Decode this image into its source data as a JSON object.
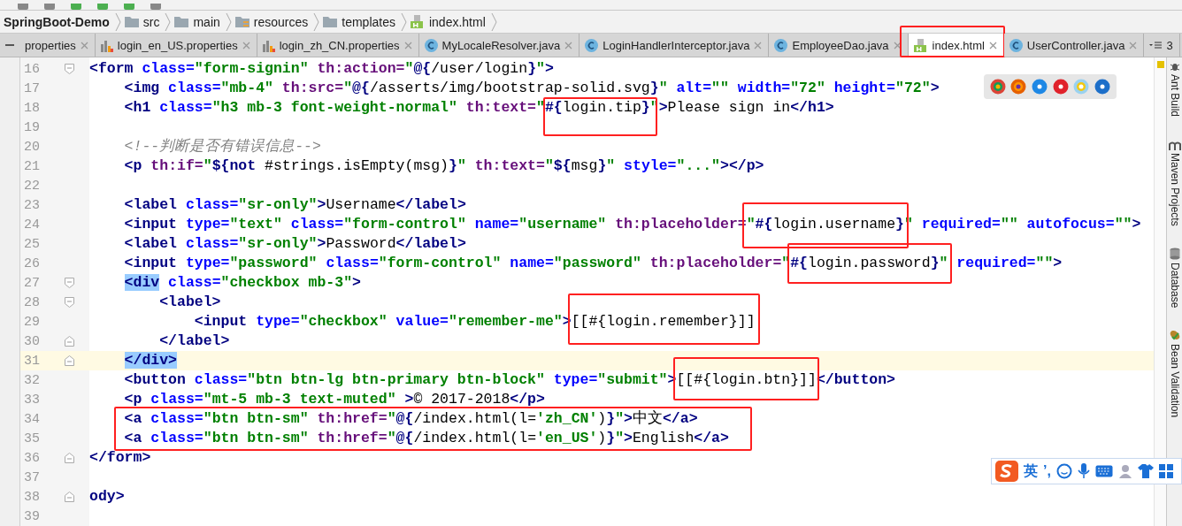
{
  "breadcrumbs": [
    {
      "label": "SpringBoot-Demo",
      "kind": "project"
    },
    {
      "label": "src",
      "kind": "folder"
    },
    {
      "label": "main",
      "kind": "folder"
    },
    {
      "label": "resources",
      "kind": "resources"
    },
    {
      "label": "templates",
      "kind": "folder"
    },
    {
      "label": "index.html",
      "kind": "html"
    }
  ],
  "tabs": [
    {
      "label": "properties",
      "kind": "cut",
      "selected": false
    },
    {
      "label": "login_en_US.properties",
      "kind": "properties",
      "selected": false
    },
    {
      "label": "login_zh_CN.properties",
      "kind": "properties",
      "selected": false
    },
    {
      "label": "MyLocaleResolver.java",
      "kind": "java",
      "selected": false
    },
    {
      "label": "LoginHandlerInterceptor.java",
      "kind": "java",
      "selected": false
    },
    {
      "label": "EmployeeDao.java",
      "kind": "java",
      "selected": false
    },
    {
      "label": "index.html",
      "kind": "html",
      "selected": true
    },
    {
      "label": "UserController.java",
      "kind": "java",
      "selected": false
    }
  ],
  "tab_overflow": "3",
  "lines": [
    {
      "number": "16",
      "fold_open": true,
      "fold_close": false,
      "current": false,
      "tokens": [
        {
          "kind": "tag",
          "text": "<form"
        },
        {
          "kind": "attr",
          "text": " class="
        },
        {
          "kind": "val",
          "text": "\"form-signin\""
        },
        {
          "kind": "th",
          "text": " th:action="
        },
        {
          "kind": "val",
          "text": "\""
        },
        {
          "kind": "tag",
          "text": "@{"
        },
        {
          "kind": "plain",
          "text": "/user/login"
        },
        {
          "kind": "tag",
          "text": "}"
        },
        {
          "kind": "val",
          "text": "\""
        },
        {
          "kind": "tag",
          "text": ">"
        }
      ]
    },
    {
      "number": "17",
      "fold_open": false,
      "fold_close": false,
      "current": false,
      "tokens": [
        {
          "kind": "tag",
          "text": "    <img"
        },
        {
          "kind": "attr",
          "text": " class="
        },
        {
          "kind": "val",
          "text": "\"mb-4\""
        },
        {
          "kind": "th",
          "text": " th:src="
        },
        {
          "kind": "val",
          "text": "\""
        },
        {
          "kind": "tag",
          "text": "@{"
        },
        {
          "kind": "plain",
          "text": "/asserts/img/bootstrap-solid.svg"
        },
        {
          "kind": "tag",
          "text": "}"
        },
        {
          "kind": "val",
          "text": "\""
        },
        {
          "kind": "attr",
          "text": " alt="
        },
        {
          "kind": "val",
          "text": "\"\""
        },
        {
          "kind": "attr",
          "text": " width="
        },
        {
          "kind": "val",
          "text": "\"72\""
        },
        {
          "kind": "attr",
          "text": " height="
        },
        {
          "kind": "val",
          "text": "\"72\""
        },
        {
          "kind": "tag",
          "text": ">"
        }
      ]
    },
    {
      "number": "18",
      "fold_open": false,
      "fold_close": false,
      "current": false,
      "tokens": [
        {
          "kind": "tag",
          "text": "    <h1"
        },
        {
          "kind": "attr",
          "text": " class="
        },
        {
          "kind": "val",
          "text": "\"h3 mb-3 font-weight-normal\""
        },
        {
          "kind": "th",
          "text": " th:text="
        },
        {
          "kind": "val",
          "text": "\""
        },
        {
          "kind": "tag",
          "text": "#{"
        },
        {
          "kind": "plain",
          "text": "login.tip"
        },
        {
          "kind": "tag",
          "text": "}"
        },
        {
          "kind": "val",
          "text": "\""
        },
        {
          "kind": "tag",
          "text": ">"
        },
        {
          "kind": "plain",
          "text": "Please sign in"
        },
        {
          "kind": "tag",
          "text": "</h1>"
        }
      ]
    },
    {
      "number": "19",
      "fold_open": false,
      "fold_close": false,
      "current": false
    },
    {
      "number": "20",
      "fold_open": false,
      "fold_close": false,
      "current": false,
      "tokens": [
        {
          "kind": "com",
          "text": "    <!--判断是否有错误信息-->"
        }
      ]
    },
    {
      "number": "21",
      "fold_open": false,
      "fold_close": false,
      "current": false,
      "tokens": [
        {
          "kind": "tag",
          "text": "    <p"
        },
        {
          "kind": "th",
          "text": " th:if="
        },
        {
          "kind": "val",
          "text": "\""
        },
        {
          "kind": "tag",
          "text": "${not "
        },
        {
          "kind": "plain",
          "text": "#strings.isEmpty(msg)"
        },
        {
          "kind": "tag",
          "text": "}"
        },
        {
          "kind": "val",
          "text": "\""
        },
        {
          "kind": "th",
          "text": " th:text="
        },
        {
          "kind": "val",
          "text": "\""
        },
        {
          "kind": "tag",
          "text": "${"
        },
        {
          "kind": "plain",
          "text": "msg"
        },
        {
          "kind": "tag",
          "text": "}"
        },
        {
          "kind": "val",
          "text": "\""
        },
        {
          "kind": "attr",
          "text": " style="
        },
        {
          "kind": "val",
          "text": "\"...\""
        },
        {
          "kind": "tag",
          "text": "></p>"
        }
      ]
    },
    {
      "number": "22",
      "fold_open": false,
      "fold_close": false,
      "current": false
    },
    {
      "number": "23",
      "fold_open": false,
      "fold_close": false,
      "current": false,
      "tokens": [
        {
          "kind": "tag",
          "text": "    <label"
        },
        {
          "kind": "attr",
          "text": " class="
        },
        {
          "kind": "val",
          "text": "\"sr-only\""
        },
        {
          "kind": "tag",
          "text": ">"
        },
        {
          "kind": "plain",
          "text": "Username"
        },
        {
          "kind": "tag",
          "text": "</label>"
        }
      ]
    },
    {
      "number": "24",
      "fold_open": false,
      "fold_close": false,
      "current": false,
      "tokens": [
        {
          "kind": "tag",
          "text": "    <input"
        },
        {
          "kind": "attr",
          "text": " type="
        },
        {
          "kind": "val",
          "text": "\"text\""
        },
        {
          "kind": "attr",
          "text": " class="
        },
        {
          "kind": "val",
          "text": "\"form-control\""
        },
        {
          "kind": "attr",
          "text": " name="
        },
        {
          "kind": "val",
          "text": "\"username\""
        },
        {
          "kind": "th",
          "text": " th:placeholder="
        },
        {
          "kind": "val",
          "text": "\""
        },
        {
          "kind": "tag",
          "text": "#{"
        },
        {
          "kind": "plain",
          "text": "login.username"
        },
        {
          "kind": "tag",
          "text": "}"
        },
        {
          "kind": "val",
          "text": "\""
        },
        {
          "kind": "attr",
          "text": " required="
        },
        {
          "kind": "val",
          "text": "\"\""
        },
        {
          "kind": "attr",
          "text": " autofocus="
        },
        {
          "kind": "val",
          "text": "\"\""
        },
        {
          "kind": "tag",
          "text": ">"
        }
      ]
    },
    {
      "number": "25",
      "fold_open": false,
      "fold_close": false,
      "current": false,
      "tokens": [
        {
          "kind": "tag",
          "text": "    <label"
        },
        {
          "kind": "attr",
          "text": " class="
        },
        {
          "kind": "val",
          "text": "\"sr-only\""
        },
        {
          "kind": "tag",
          "text": ">"
        },
        {
          "kind": "plain",
          "text": "Password"
        },
        {
          "kind": "tag",
          "text": "</label>"
        }
      ]
    },
    {
      "number": "26",
      "fold_open": false,
      "fold_close": false,
      "current": false,
      "tokens": [
        {
          "kind": "tag",
          "text": "    <input"
        },
        {
          "kind": "attr",
          "text": " type="
        },
        {
          "kind": "val",
          "text": "\"password\""
        },
        {
          "kind": "attr",
          "text": " class="
        },
        {
          "kind": "val",
          "text": "\"form-control\""
        },
        {
          "kind": "attr",
          "text": " name="
        },
        {
          "kind": "val",
          "text": "\"password\""
        },
        {
          "kind": "th",
          "text": " th:placeholder="
        },
        {
          "kind": "val",
          "text": "\""
        },
        {
          "kind": "tag",
          "text": "#{"
        },
        {
          "kind": "plain",
          "text": "login.password"
        },
        {
          "kind": "tag",
          "text": "}"
        },
        {
          "kind": "val",
          "text": "\""
        },
        {
          "kind": "attr",
          "text": " required="
        },
        {
          "kind": "val",
          "text": "\"\""
        },
        {
          "kind": "tag",
          "text": ">"
        }
      ]
    },
    {
      "number": "27",
      "fold_open": true,
      "fold_close": false,
      "current": false,
      "tokens": [
        {
          "kind": "match",
          "text": "    <div"
        },
        {
          "kind": "attr",
          "text": " class="
        },
        {
          "kind": "val",
          "text": "\"checkbox mb-3\""
        },
        {
          "kind": "tag",
          "text": ">"
        }
      ]
    },
    {
      "number": "28",
      "fold_open": true,
      "fold_close": false,
      "current": false,
      "tokens": [
        {
          "kind": "tag",
          "text": "        <label>"
        }
      ]
    },
    {
      "number": "29",
      "fold_open": false,
      "fold_close": false,
      "current": false,
      "tokens": [
        {
          "kind": "tag",
          "text": "            <input"
        },
        {
          "kind": "attr",
          "text": " type="
        },
        {
          "kind": "val",
          "text": "\"checkbox\""
        },
        {
          "kind": "attr",
          "text": " value="
        },
        {
          "kind": "val",
          "text": "\"remember-me\""
        },
        {
          "kind": "tag",
          "text": ">"
        },
        {
          "kind": "plain",
          "text": "[[#{login.remember}]]"
        }
      ]
    },
    {
      "number": "30",
      "fold_open": false,
      "fold_close": true,
      "current": false,
      "tokens": [
        {
          "kind": "tag",
          "text": "        </label>"
        }
      ]
    },
    {
      "number": "31",
      "fold_open": false,
      "fold_close": true,
      "current": true,
      "tokens": [
        {
          "kind": "match",
          "text": "    </div>"
        }
      ]
    },
    {
      "number": "32",
      "fold_open": false,
      "fold_close": false,
      "current": false,
      "tokens": [
        {
          "kind": "tag",
          "text": "    <button"
        },
        {
          "kind": "attr",
          "text": " class="
        },
        {
          "kind": "val",
          "text": "\"btn btn-lg btn-primary btn-block\""
        },
        {
          "kind": "attr",
          "text": " type="
        },
        {
          "kind": "val",
          "text": "\"submit\""
        },
        {
          "kind": "tag",
          "text": ">"
        },
        {
          "kind": "plain",
          "text": "[[#{login.btn}]]"
        },
        {
          "kind": "tag",
          "text": "</button>"
        }
      ]
    },
    {
      "number": "33",
      "fold_open": false,
      "fold_close": false,
      "current": false,
      "tokens": [
        {
          "kind": "tag",
          "text": "    <p"
        },
        {
          "kind": "attr",
          "text": " class="
        },
        {
          "kind": "val",
          "text": "\"mt-5 mb-3 text-muted\""
        },
        {
          "kind": "tag",
          "text": " >"
        },
        {
          "kind": "plain",
          "text": "© 2017-2018"
        },
        {
          "kind": "tag",
          "text": "</p>"
        }
      ]
    },
    {
      "number": "34",
      "fold_open": false,
      "fold_close": false,
      "current": false,
      "tokens": [
        {
          "kind": "tag",
          "text": "    <a"
        },
        {
          "kind": "attr",
          "text": " class="
        },
        {
          "kind": "val",
          "text": "\"btn btn-sm\""
        },
        {
          "kind": "th",
          "text": " th:href="
        },
        {
          "kind": "val",
          "text": "\""
        },
        {
          "kind": "tag",
          "text": "@{"
        },
        {
          "kind": "plain",
          "text": "/index.html(l="
        },
        {
          "kind": "val",
          "text": "'zh_CN'"
        },
        {
          "kind": "plain",
          "text": ")"
        },
        {
          "kind": "tag",
          "text": "}"
        },
        {
          "kind": "val",
          "text": "\""
        },
        {
          "kind": "tag",
          "text": ">"
        },
        {
          "kind": "plain",
          "text": "中文"
        },
        {
          "kind": "tag",
          "text": "</a>"
        }
      ]
    },
    {
      "number": "35",
      "fold_open": false,
      "fold_close": false,
      "current": false,
      "tokens": [
        {
          "kind": "tag",
          "text": "    <a"
        },
        {
          "kind": "attr",
          "text": " class="
        },
        {
          "kind": "val",
          "text": "\"btn btn-sm\""
        },
        {
          "kind": "th",
          "text": " th:href="
        },
        {
          "kind": "val",
          "text": "\""
        },
        {
          "kind": "tag",
          "text": "@{"
        },
        {
          "kind": "plain",
          "text": "/index.html(l="
        },
        {
          "kind": "val",
          "text": "'en_US'"
        },
        {
          "kind": "plain",
          "text": ")"
        },
        {
          "kind": "tag",
          "text": "}"
        },
        {
          "kind": "val",
          "text": "\""
        },
        {
          "kind": "tag",
          "text": ">"
        },
        {
          "kind": "plain",
          "text": "English"
        },
        {
          "kind": "tag",
          "text": "</a>"
        }
      ]
    },
    {
      "number": "36",
      "fold_open": false,
      "fold_close": true,
      "current": false,
      "tokens": [
        {
          "kind": "tag",
          "text": "</form>"
        }
      ]
    },
    {
      "number": "37",
      "fold_open": false,
      "fold_close": false,
      "current": false
    },
    {
      "number": "38",
      "fold_open": false,
      "fold_close": true,
      "current": false,
      "tokens": [
        {
          "kind": "tag",
          "text": "ody>"
        }
      ]
    },
    {
      "number": "39",
      "fold_open": false,
      "fold_close": false,
      "current": false
    }
  ],
  "tool_windows": [
    {
      "label": "Ant Build",
      "kind": "ant"
    },
    {
      "label": "Maven Projects",
      "kind": "maven"
    },
    {
      "label": "Database",
      "kind": "database"
    },
    {
      "label": "Bean Validation",
      "kind": "bean"
    }
  ],
  "ime_bar": {
    "mode": "英",
    "punctuation": "’,"
  }
}
